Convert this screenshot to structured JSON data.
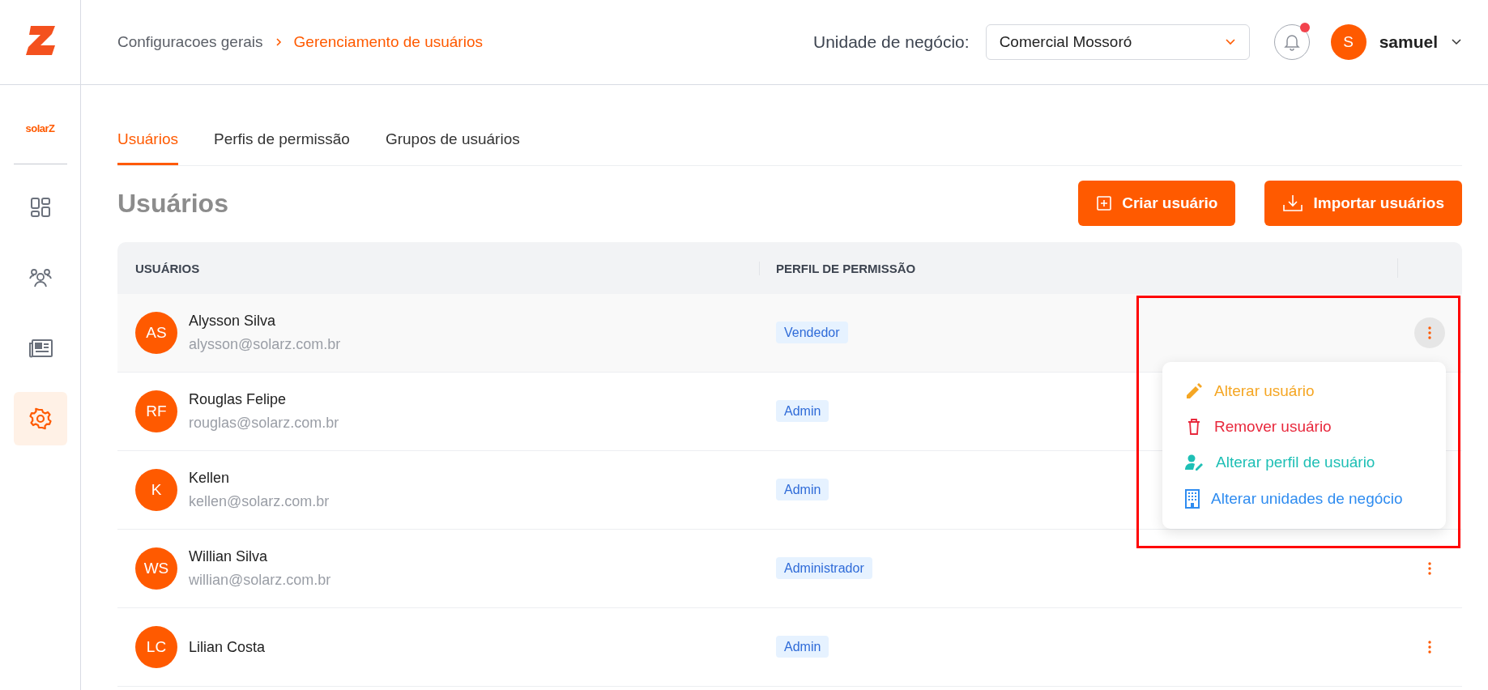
{
  "sidebar": {
    "brand": "solarZ",
    "items": [
      {
        "kind": "dashboard",
        "selected": false
      },
      {
        "kind": "people",
        "selected": false
      },
      {
        "kind": "news",
        "selected": false
      },
      {
        "kind": "settings",
        "selected": true
      }
    ]
  },
  "header": {
    "breadcrumb": [
      "Configuracoes gerais",
      "Gerenciamento de usuários"
    ],
    "business_unit": {
      "label": "Unidade de negócio:",
      "value": "Comercial Mossoró"
    },
    "notifications": {
      "unread": true
    },
    "user": {
      "initial": "S",
      "name": "samuel"
    }
  },
  "tabs": [
    {
      "label": "Usuários",
      "selected": true
    },
    {
      "label": "Perfis de permissão",
      "selected": false
    },
    {
      "label": "Grupos de usuários",
      "selected": false
    }
  ],
  "page": {
    "title": "Usuários",
    "buttons": [
      {
        "kind": "create",
        "label": "Criar usuário"
      },
      {
        "kind": "import",
        "label": "Importar usuários"
      }
    ]
  },
  "table": {
    "columns": [
      "USUÁRIOS",
      "PERFIL DE PERMISSÃO"
    ],
    "rows": [
      {
        "initials": "AS",
        "name": "Alysson Silva",
        "email": "alysson@solarz.com.br",
        "profile": "Vendedor",
        "menu_open": true
      },
      {
        "initials": "RF",
        "name": "Rouglas Felipe",
        "email": "rouglas@solarz.com.br",
        "profile": "Admin",
        "menu_open": false
      },
      {
        "initials": "K",
        "name": "Kellen",
        "email": "kellen@solarz.com.br",
        "profile": "Admin",
        "menu_open": false
      },
      {
        "initials": "WS",
        "name": "Willian Silva",
        "email": "willian@solarz.com.br",
        "profile": "Administrador",
        "menu_open": false
      },
      {
        "initials": "LC",
        "name": "Lilian Costa",
        "profile": "Admin",
        "menu_open": false
      }
    ]
  },
  "row_menu": [
    {
      "kind": "edit",
      "label": "Alterar usuário",
      "color": "#f5a623"
    },
    {
      "kind": "delete",
      "label": "Remover usuário",
      "color": "#e8283c"
    },
    {
      "kind": "profile",
      "label": "Alterar perfil de usuário",
      "color": "#1ebfb5"
    },
    {
      "kind": "units",
      "label": "Alterar unidades de negócio",
      "color": "#2f8cf0"
    }
  ]
}
